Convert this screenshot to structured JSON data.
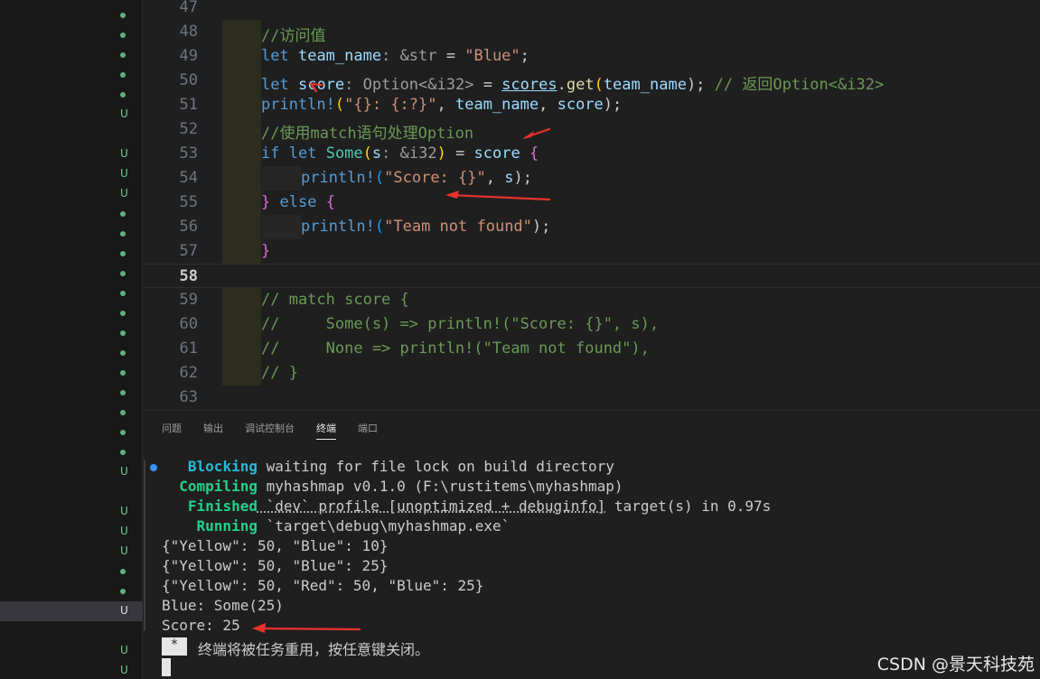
{
  "explorer": {
    "row_markers": [
      "dot",
      "dot",
      "dot",
      "dot",
      "dot",
      "U",
      "",
      "U",
      "U",
      "U",
      "dot",
      "dot",
      "dot",
      "dot",
      "dot",
      "dot",
      "dot",
      "dot",
      "dot",
      "dot",
      "dot",
      "dot",
      "dot",
      "U",
      "",
      "U",
      "U",
      "U",
      "dot",
      "dot",
      "U",
      "",
      "U",
      "U"
    ],
    "selected_index": 30,
    "untracked_label": "U"
  },
  "editor": {
    "lines": [
      {
        "num": "47"
      },
      {
        "num": "48",
        "t": [
          "//访问值"
        ]
      },
      {
        "num": "49",
        "t": [
          "let",
          " ",
          "team_name",
          ": &str",
          " = ",
          "\"Blue\"",
          ";"
        ]
      },
      {
        "num": "50",
        "t": [
          "let",
          " ",
          "score",
          ": Option<&i32>",
          " = ",
          "scores",
          ".",
          "get",
          "(",
          "team_name",
          ");",
          " // 返回Option<&i32>"
        ]
      },
      {
        "num": "51",
        "t": [
          "println!",
          "(",
          "\"{}: {:?}\"",
          ", ",
          "team_name",
          ", ",
          "score",
          ");"
        ]
      },
      {
        "num": "52",
        "t": [
          "//使用match语句处理Option"
        ]
      },
      {
        "num": "53",
        "t": [
          "if",
          " ",
          "let",
          " ",
          "Some",
          "(",
          "s",
          ": &i32",
          ")",
          " = ",
          "score",
          " ",
          "{"
        ]
      },
      {
        "num": "54",
        "t": [
          "println!",
          "(",
          "\"Score: {}\"",
          ", ",
          "s",
          ");"
        ]
      },
      {
        "num": "55",
        "t": [
          "}",
          " ",
          "else",
          " ",
          "{"
        ]
      },
      {
        "num": "56",
        "t": [
          "println!",
          "(",
          "\"Team not found\"",
          ");"
        ]
      },
      {
        "num": "57",
        "t": [
          "}"
        ]
      },
      {
        "num": "58"
      },
      {
        "num": "59",
        "t": [
          "// match score {"
        ]
      },
      {
        "num": "60",
        "t": [
          "//     Some(s) => println!(\"Score: {}\", s),"
        ]
      },
      {
        "num": "61",
        "t": [
          "//     None => println!(\"Team not found\"),"
        ]
      },
      {
        "num": "62",
        "t": [
          "// }"
        ]
      },
      {
        "num": "63"
      }
    ]
  },
  "panel": {
    "tabs": [
      {
        "label": "问题",
        "active": false
      },
      {
        "label": "输出",
        "active": false
      },
      {
        "label": "调试控制台",
        "active": false
      },
      {
        "label": "终端",
        "active": true
      },
      {
        "label": "端口",
        "active": false
      }
    ],
    "terminal": [
      {
        "kw": "Blocking",
        "rest": " waiting for file lock on build directory",
        "color": "blue"
      },
      {
        "kw": "Compiling",
        "rest": " myhashmap v0.1.0 (F:\\rustitems\\myhashmap)",
        "color": "green"
      },
      {
        "kw": "Finished",
        "rest_a": " `dev` profile [unoptimized + debuginfo]",
        "rest_b": " target(s) in 0.97s",
        "color": "green"
      },
      {
        "kw": "Running",
        "rest": " `target\\debug\\myhashmap.exe`",
        "color": "green"
      },
      {
        "text": "{\"Yellow\": 50, \"Blue\": 10}"
      },
      {
        "text": "{\"Yellow\": 50, \"Blue\": 25}"
      },
      {
        "text": "{\"Yellow\": 50, \"Red\": 50, \"Blue\": 25}"
      },
      {
        "text": "Blue: Some(25)"
      },
      {
        "text": "Score: 25"
      }
    ],
    "prompt_marker": "*",
    "reuse_message": "终端将被任务重用，按任意键关闭。"
  },
  "watermark": "CSDN @景天科技苑",
  "colors": {
    "arrow": "#e8322b",
    "gutter_guide": "#2d2d1f"
  }
}
